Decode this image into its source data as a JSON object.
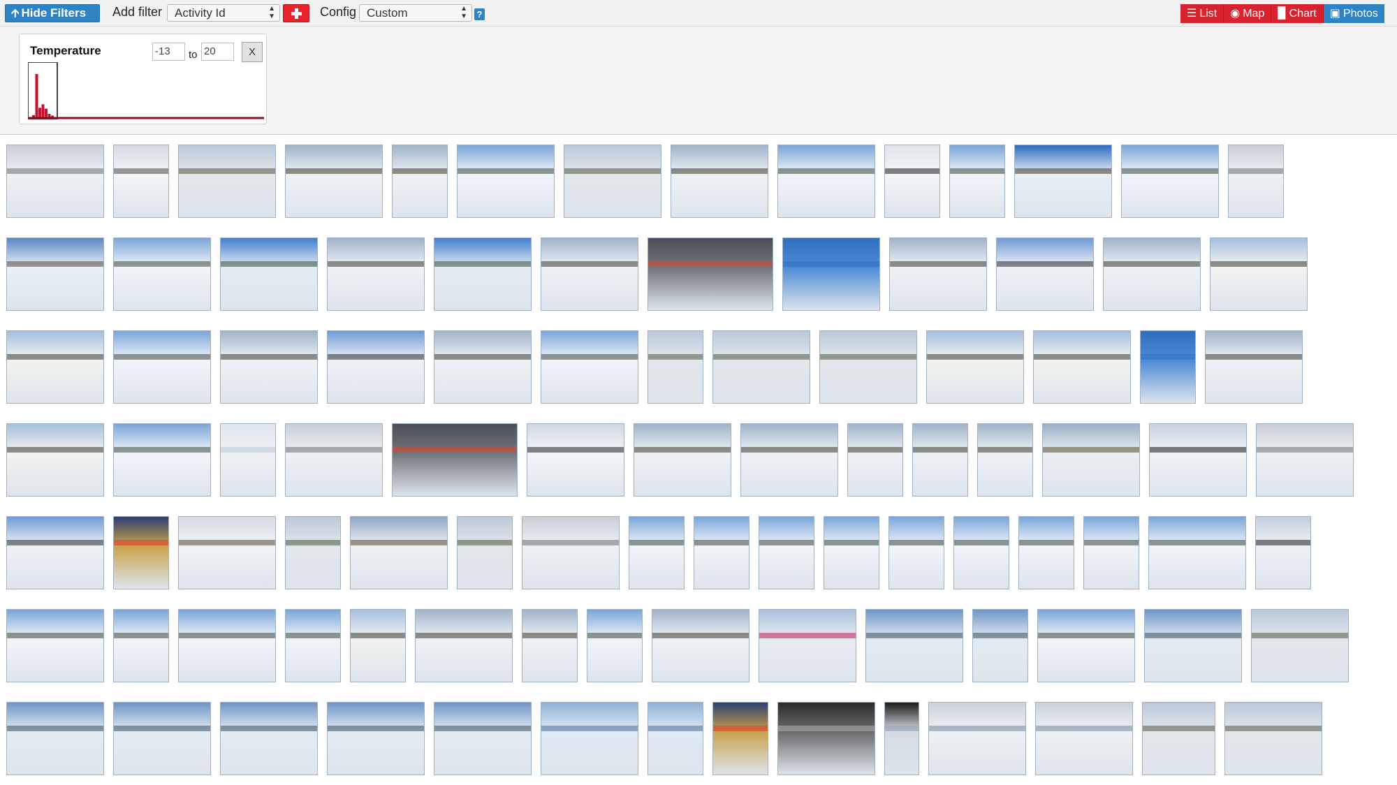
{
  "toolbar": {
    "hide_filters_label": "Hide Filters",
    "add_filter_label": "Add filter",
    "add_filter_value": "Activity Id",
    "config_label": "Config",
    "config_value": "Custom",
    "help_label": "?",
    "accent": "#2e83c4",
    "danger": "#d8232e"
  },
  "tabs": [
    {
      "label": "List",
      "icon": "list-icon"
    },
    {
      "label": "Map",
      "icon": "globe-icon"
    },
    {
      "label": "Chart",
      "icon": "bar-chart-icon"
    },
    {
      "label": "Photos",
      "icon": "camera-icon",
      "active": true
    }
  ],
  "filter": {
    "title": "Temperature",
    "min": "-13",
    "to_label": "to",
    "max": "20",
    "remove_label": "X"
  },
  "photos": [
    [
      {
        "w": 140,
        "s": "overcast"
      },
      {
        "w": 80,
        "s": "tree"
      },
      {
        "w": 140,
        "s": "road"
      },
      {
        "w": 140,
        "s": "woods"
      },
      {
        "w": 80,
        "s": "woods"
      },
      {
        "w": 140,
        "s": "field"
      },
      {
        "w": 140,
        "s": "road"
      },
      {
        "w": 140,
        "s": "woods"
      },
      {
        "w": 140,
        "s": "field"
      },
      {
        "w": 80,
        "s": "hand"
      },
      {
        "w": 80,
        "s": "field"
      },
      {
        "w": 140,
        "s": "barn"
      },
      {
        "w": 140,
        "s": "field"
      },
      {
        "w": 80,
        "s": "overcast"
      }
    ],
    [
      {
        "w": 140,
        "s": "fence"
      },
      {
        "w": 140,
        "s": "field"
      },
      {
        "w": 140,
        "s": "sky"
      },
      {
        "w": 140,
        "s": "woods"
      },
      {
        "w": 140,
        "s": "sky"
      },
      {
        "w": 140,
        "s": "woods"
      },
      {
        "w": 180,
        "s": "game"
      },
      {
        "w": 140,
        "s": "blue"
      },
      {
        "w": 140,
        "s": "woods"
      },
      {
        "w": 140,
        "s": "rider"
      },
      {
        "w": 140,
        "s": "woods"
      },
      {
        "w": 140,
        "s": "sunset"
      }
    ],
    [
      {
        "w": 140,
        "s": "sunset"
      },
      {
        "w": 140,
        "s": "field"
      },
      {
        "w": 140,
        "s": "woods"
      },
      {
        "w": 140,
        "s": "rider"
      },
      {
        "w": 140,
        "s": "woods"
      },
      {
        "w": 140,
        "s": "field"
      },
      {
        "w": 80,
        "s": "road"
      },
      {
        "w": 140,
        "s": "road"
      },
      {
        "w": 140,
        "s": "road"
      },
      {
        "w": 140,
        "s": "sunset"
      },
      {
        "w": 140,
        "s": "sunset"
      },
      {
        "w": 80,
        "s": "blue"
      },
      {
        "w": 140,
        "s": "woods"
      }
    ],
    [
      {
        "w": 140,
        "s": "sunset"
      },
      {
        "w": 140,
        "s": "field"
      },
      {
        "w": 80,
        "s": "snow"
      },
      {
        "w": 140,
        "s": "overcast"
      },
      {
        "w": 180,
        "s": "game"
      },
      {
        "w": 140,
        "s": "bike"
      },
      {
        "w": 140,
        "s": "woods"
      },
      {
        "w": 140,
        "s": "woods"
      },
      {
        "w": 80,
        "s": "woods"
      },
      {
        "w": 80,
        "s": "woods"
      },
      {
        "w": 80,
        "s": "woods"
      },
      {
        "w": 140,
        "s": "trunk"
      },
      {
        "w": 140,
        "s": "handle"
      },
      {
        "w": 140,
        "s": "overcast"
      }
    ],
    [
      {
        "w": 140,
        "s": "rider"
      },
      {
        "w": 80,
        "s": "screen"
      },
      {
        "w": 140,
        "s": "church"
      },
      {
        "w": 80,
        "s": "road"
      },
      {
        "w": 140,
        "s": "bridge"
      },
      {
        "w": 80,
        "s": "road"
      },
      {
        "w": 140,
        "s": "overcast"
      },
      {
        "w": 80,
        "s": "field"
      },
      {
        "w": 80,
        "s": "field"
      },
      {
        "w": 80,
        "s": "field"
      },
      {
        "w": 80,
        "s": "field"
      },
      {
        "w": 80,
        "s": "field"
      },
      {
        "w": 80,
        "s": "field"
      },
      {
        "w": 80,
        "s": "field"
      },
      {
        "w": 80,
        "s": "field"
      },
      {
        "w": 140,
        "s": "field"
      },
      {
        "w": 80,
        "s": "tube"
      }
    ],
    [
      {
        "w": 140,
        "s": "field"
      },
      {
        "w": 80,
        "s": "field"
      },
      {
        "w": 140,
        "s": "field"
      },
      {
        "w": 80,
        "s": "field"
      },
      {
        "w": 80,
        "s": "sunset"
      },
      {
        "w": 140,
        "s": "woods"
      },
      {
        "w": 80,
        "s": "woods"
      },
      {
        "w": 80,
        "s": "field"
      },
      {
        "w": 140,
        "s": "woods"
      },
      {
        "w": 140,
        "s": "selfie"
      },
      {
        "w": 140,
        "s": "creek"
      },
      {
        "w": 80,
        "s": "creek"
      },
      {
        "w": 140,
        "s": "field"
      },
      {
        "w": 140,
        "s": "creek"
      },
      {
        "w": 140,
        "s": "road"
      }
    ],
    [
      {
        "w": 140,
        "s": "creek"
      },
      {
        "w": 140,
        "s": "creek"
      },
      {
        "w": 140,
        "s": "creek"
      },
      {
        "w": 140,
        "s": "creek"
      },
      {
        "w": 140,
        "s": "creek"
      },
      {
        "w": 140,
        "s": "ice"
      },
      {
        "w": 80,
        "s": "ice"
      },
      {
        "w": 80,
        "s": "screen"
      },
      {
        "w": 140,
        "s": "desk"
      },
      {
        "w": 50,
        "s": "phone"
      },
      {
        "w": 140,
        "s": "house"
      },
      {
        "w": 140,
        "s": "house"
      },
      {
        "w": 105,
        "s": "road"
      },
      {
        "w": 140,
        "s": "road"
      }
    ]
  ],
  "histogram": {
    "bars": [
      0.05,
      1.0,
      0.22,
      0.3,
      0.2,
      0.08,
      0.04
    ],
    "color": "#c8102e"
  }
}
